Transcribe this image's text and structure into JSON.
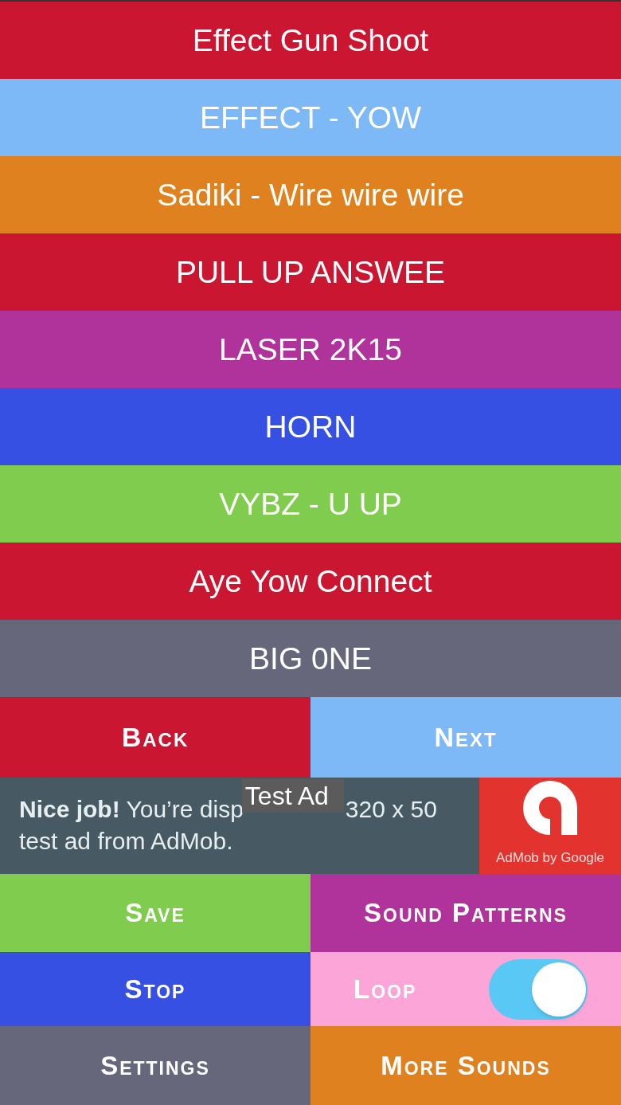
{
  "sounds": [
    {
      "label": "Effect Gun Shoot",
      "color": "#cb1632"
    },
    {
      "label": "EFFECT - YOW",
      "color": "#7db8f7"
    },
    {
      "label": "Sadiki - Wire wire wire",
      "color": "#e0811f"
    },
    {
      "label": "PULL UP ANSWEE",
      "color": "#cb1632"
    },
    {
      "label": "LASER 2K15",
      "color": "#b0339b"
    },
    {
      "label": "HORN",
      "color": "#3550e3"
    },
    {
      "label": "VYBZ - U UP",
      "color": "#80cc4e"
    },
    {
      "label": "Aye Yow Connect",
      "color": "#cb1632"
    },
    {
      "label": "BIG 0NE",
      "color": "#66677a"
    }
  ],
  "pager": [
    {
      "label": "Back",
      "color": "#cb1632"
    },
    {
      "label": "Next",
      "color": "#7db8f7"
    }
  ],
  "ad": {
    "badge": "Test Ad",
    "line_1_start": "**Nice job!** You’re disp",
    "line_1_end": "320 x 50",
    "line_2": "test ad from AdMob.",
    "brand": "AdMob by Google"
  },
  "controls": [
    {
      "kind": "button",
      "label": "Save",
      "color": "#80cc4e"
    },
    {
      "kind": "button",
      "label": "Sound Patterns",
      "color": "#b0339b"
    },
    {
      "kind": "button",
      "label": "Stop",
      "color": "#3550e3"
    },
    {
      "kind": "toggle",
      "label": "Loop",
      "color": "#fca5d8",
      "on": true
    },
    {
      "kind": "button",
      "label": "Settings",
      "color": "#66677a"
    },
    {
      "kind": "button",
      "label": "More Sounds",
      "color": "#e0811f"
    }
  ]
}
